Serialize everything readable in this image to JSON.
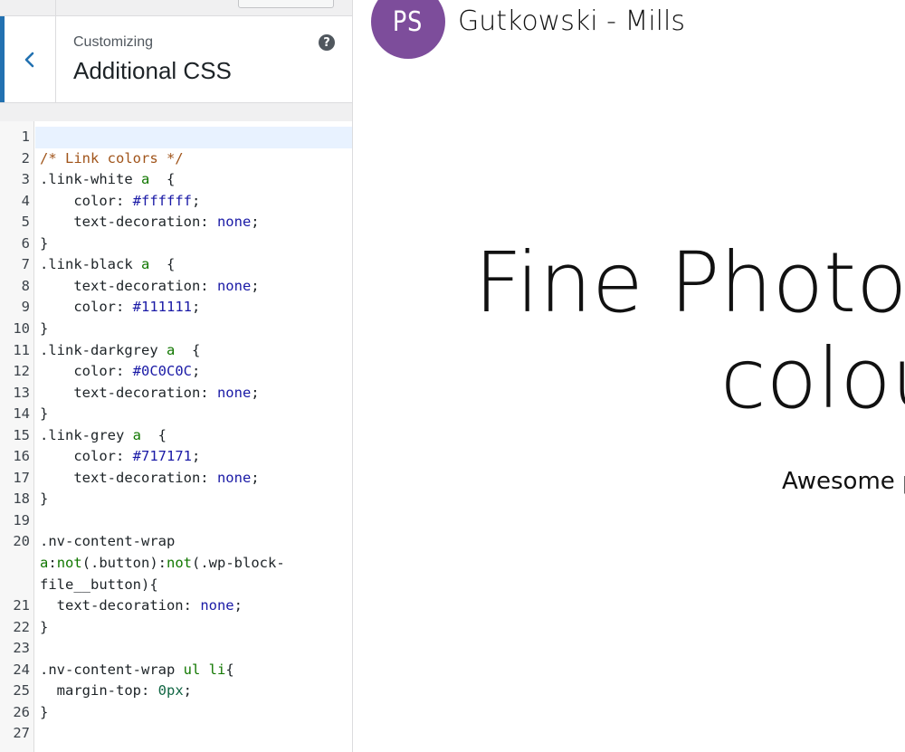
{
  "customizer": {
    "breadcrumb": "Customizing",
    "section_title": "Additional CSS",
    "help_label": "?"
  },
  "editor": {
    "lines": [
      {
        "n": "1",
        "html": ""
      },
      {
        "n": "2",
        "html": "<span class=\"c-comment\">/* Link colors */</span>"
      },
      {
        "n": "3",
        "html": ".link-white <span class=\"c-tag\">a</span>  {"
      },
      {
        "n": "4",
        "html": "    color: <span class=\"c-val\">#ffffff</span>;"
      },
      {
        "n": "5",
        "html": "    text-decoration: <span class=\"c-val\">none</span>;"
      },
      {
        "n": "6",
        "html": "}"
      },
      {
        "n": "7",
        "html": ".link-black <span class=\"c-tag\">a</span>  {"
      },
      {
        "n": "8",
        "html": "    text-decoration: <span class=\"c-val\">none</span>;"
      },
      {
        "n": "9",
        "html": "    color: <span class=\"c-val\">#111111</span>;"
      },
      {
        "n": "10",
        "html": "}"
      },
      {
        "n": "11",
        "html": ".link-darkgrey <span class=\"c-tag\">a</span>  {"
      },
      {
        "n": "12",
        "html": "    color: <span class=\"c-val\">#0C0C0C</span>;"
      },
      {
        "n": "13",
        "html": "    text-decoration: <span class=\"c-val\">none</span>;"
      },
      {
        "n": "14",
        "html": "}"
      },
      {
        "n": "15",
        "html": ".link-grey <span class=\"c-tag\">a</span>  {"
      },
      {
        "n": "16",
        "html": "    color: <span class=\"c-val\">#717171</span>;"
      },
      {
        "n": "17",
        "html": "    text-decoration: <span class=\"c-val\">none</span>;"
      },
      {
        "n": "18",
        "html": "}"
      },
      {
        "n": "19",
        "html": ""
      },
      {
        "n": "20",
        "html": ".nv-content-wrap"
      },
      {
        "n": "",
        "html": "<span class=\"c-tag\">a</span>:<span class=\"c-tag\">not</span>(.button):<span class=\"c-tag\">not</span>(.wp-block-"
      },
      {
        "n": "",
        "html": "file__button){"
      },
      {
        "n": "21",
        "html": "  text-decoration: <span class=\"c-val\">none</span>;"
      },
      {
        "n": "22",
        "html": "}"
      },
      {
        "n": "23",
        "html": ""
      },
      {
        "n": "24",
        "html": ".nv-content-wrap <span class=\"c-tag\">ul</span> <span class=\"c-tag\">li</span>{"
      },
      {
        "n": "25",
        "html": "  margin-top: <span class=\"c-num\">0px</span>;"
      },
      {
        "n": "26",
        "html": "}"
      },
      {
        "n": "27",
        "html": ""
      }
    ]
  },
  "preview": {
    "logo_initials": "PS",
    "site_title": "Gutkowski - Mills",
    "hero_line1": "Fine Photo P",
    "hero_line2": "colou",
    "hero_sub": "Awesome p",
    "logo_color": "#7d4d9b"
  },
  "colors": {
    "accent": "#2271b1",
    "sidebar_bg": "#f0f0f1",
    "active_line": "#e8f2ff"
  }
}
